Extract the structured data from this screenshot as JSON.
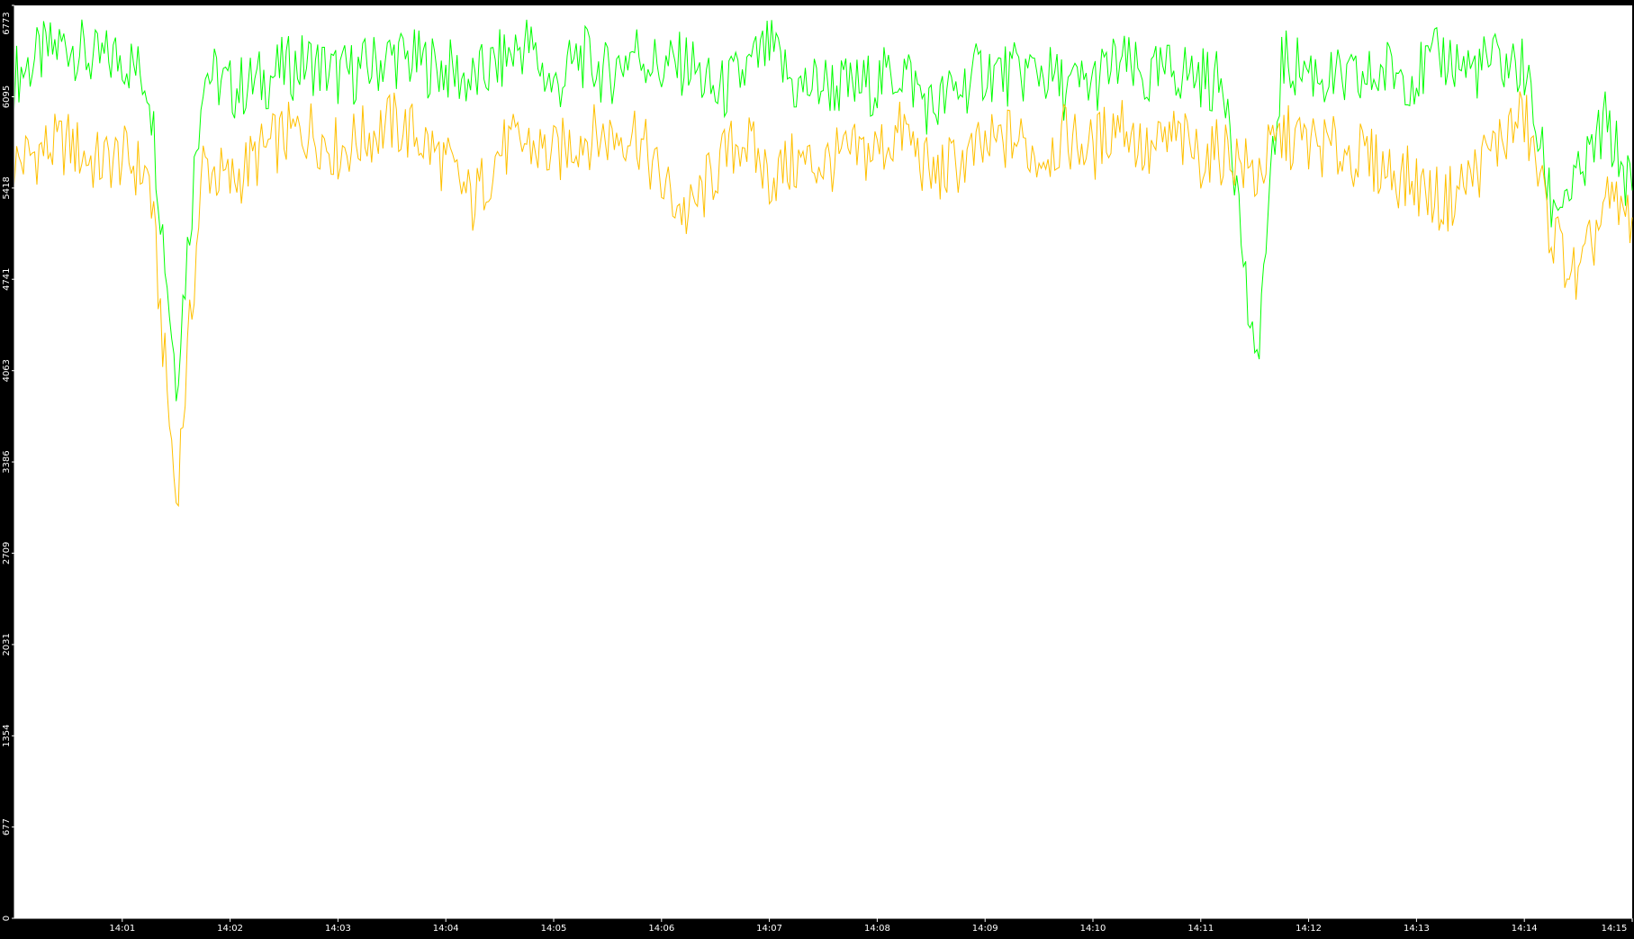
{
  "colors": {
    "background": "#000000",
    "plot_background": "#ffffff",
    "axis": "#ffffff",
    "tick_text": "#ffffff"
  },
  "chart_data": {
    "type": "line",
    "title": "",
    "xlabel": "",
    "ylabel": "",
    "grid": false,
    "legend": "none",
    "ylim": [
      0,
      6773
    ],
    "xlim": [
      "14:00:00",
      "14:15:00"
    ],
    "y_ticks": [
      "0",
      "677",
      "1354",
      "2031",
      "2709",
      "3386",
      "4063",
      "4741",
      "5418",
      "6095",
      "6773"
    ],
    "x_ticks": [
      "14:01",
      "14:02",
      "14:03",
      "14:04",
      "14:05",
      "14:06",
      "14:07",
      "14:08",
      "14:09",
      "14:10",
      "14:11",
      "14:12",
      "14:13",
      "14:14",
      "14:15"
    ],
    "x": [
      "14:00:00",
      "14:00:15",
      "14:00:30",
      "14:00:45",
      "14:01:00",
      "14:01:15",
      "14:01:30",
      "14:01:45",
      "14:02:00",
      "14:02:15",
      "14:02:30",
      "14:02:45",
      "14:03:00",
      "14:03:15",
      "14:03:30",
      "14:03:45",
      "14:04:00",
      "14:04:15",
      "14:04:30",
      "14:04:45",
      "14:05:00",
      "14:05:15",
      "14:05:30",
      "14:05:45",
      "14:06:00",
      "14:06:15",
      "14:06:30",
      "14:06:45",
      "14:07:00",
      "14:07:15",
      "14:07:30",
      "14:07:45",
      "14:08:00",
      "14:08:15",
      "14:08:30",
      "14:08:45",
      "14:09:00",
      "14:09:15",
      "14:09:30",
      "14:09:45",
      "14:10:00",
      "14:10:15",
      "14:10:30",
      "14:10:45",
      "14:11:00",
      "14:11:15",
      "14:11:30",
      "14:11:45",
      "14:12:00",
      "14:12:15",
      "14:12:30",
      "14:12:45",
      "14:13:00",
      "14:13:15",
      "14:13:30",
      "14:13:45",
      "14:14:00",
      "14:14:15",
      "14:14:30",
      "14:14:45",
      "14:15:00"
    ],
    "series": [
      {
        "color": "#00ff00",
        "values": [
          6250,
          6400,
          6500,
          6350,
          6400,
          6200,
          4000,
          6300,
          6150,
          6200,
          6300,
          6350,
          6250,
          6300,
          6400,
          6350,
          6300,
          6200,
          6350,
          6500,
          6150,
          6400,
          6250,
          6450,
          6300,
          6350,
          6100,
          6250,
          6450,
          6150,
          6200,
          6150,
          6200,
          6300,
          6000,
          6150,
          6300,
          6250,
          6300,
          6150,
          6200,
          6350,
          6200,
          6300,
          6250,
          6150,
          4000,
          6350,
          6300,
          6200,
          6200,
          6300,
          6250,
          6400,
          6300,
          6350,
          6300,
          5300,
          5450,
          5900,
          5400
        ]
      },
      {
        "color": "#ffc000",
        "values": [
          5600,
          5700,
          5750,
          5600,
          5650,
          5500,
          3100,
          5600,
          5450,
          5650,
          5800,
          5850,
          5700,
          5800,
          5900,
          5800,
          5600,
          5300,
          5700,
          5750,
          5650,
          5800,
          5800,
          5850,
          5450,
          5200,
          5550,
          5800,
          5500,
          5600,
          5600,
          5650,
          5700,
          5850,
          5500,
          5600,
          5700,
          5800,
          5650,
          5800,
          5700,
          5950,
          5650,
          5800,
          5650,
          5700,
          5500,
          5800,
          5750,
          5700,
          5650,
          5550,
          5450,
          5300,
          5500,
          5750,
          5950,
          5100,
          4700,
          5300,
          5200
        ]
      }
    ]
  }
}
